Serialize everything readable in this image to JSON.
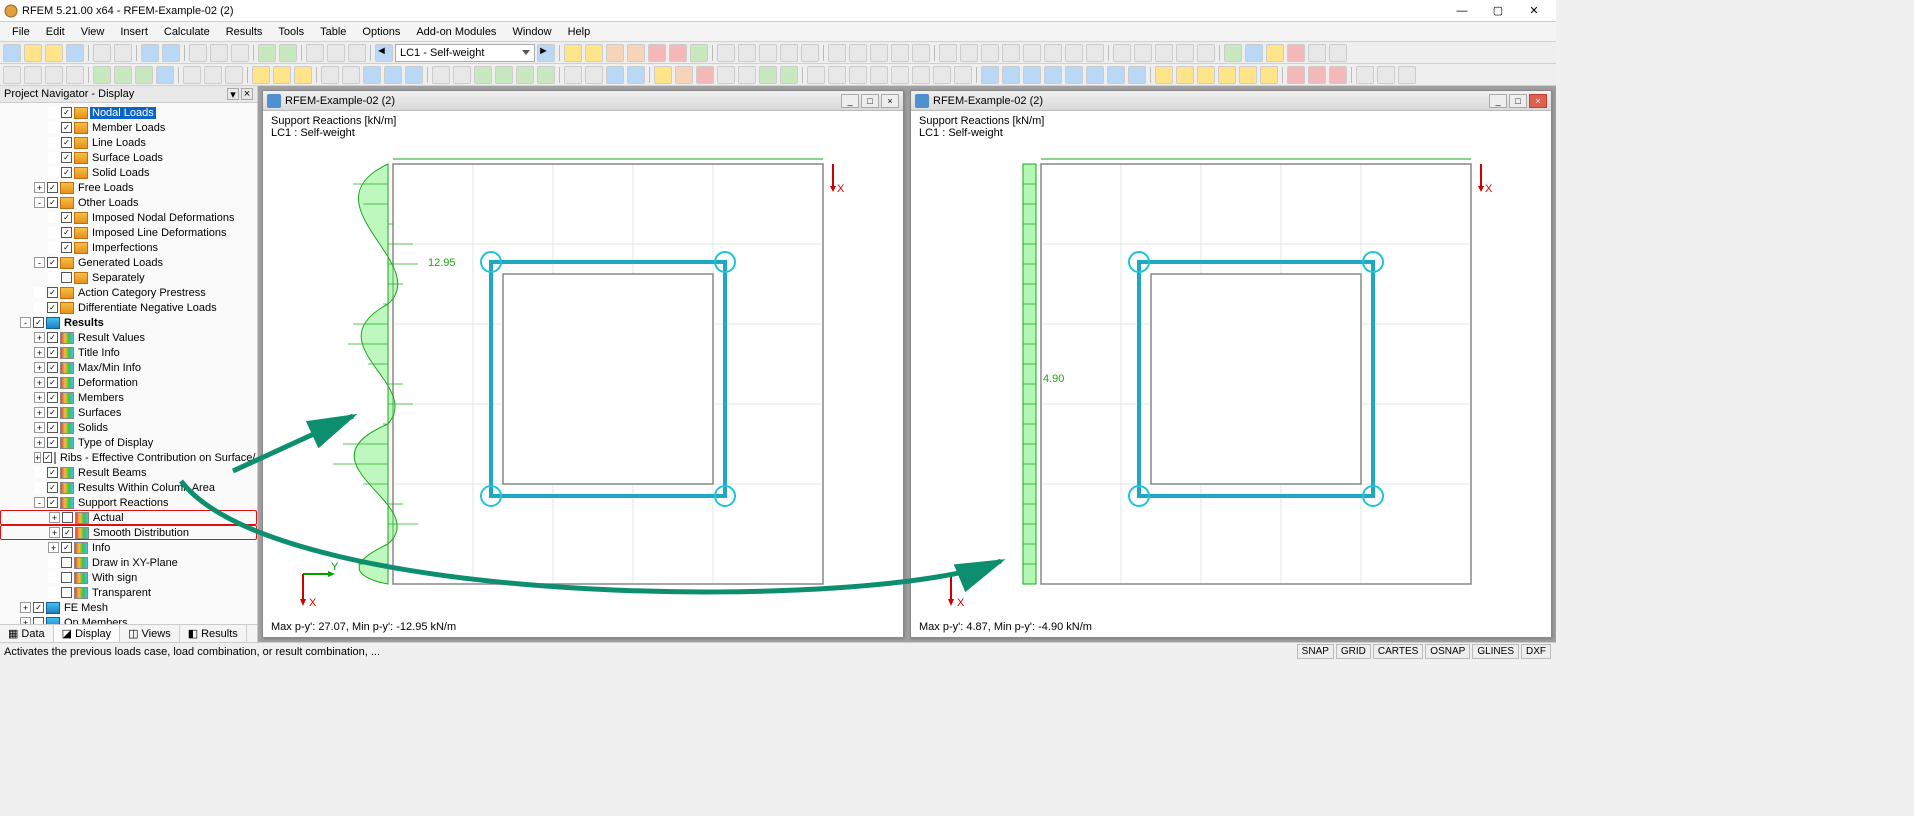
{
  "window": {
    "title": "RFEM 5.21.00 x64 - RFEM-Example-02 (2)"
  },
  "menu": {
    "items": [
      "File",
      "Edit",
      "View",
      "Insert",
      "Calculate",
      "Results",
      "Tools",
      "Table",
      "Options",
      "Add-on Modules",
      "Window",
      "Help"
    ]
  },
  "loadcase_combo": "LC1 - Self-weight",
  "navigator": {
    "title": "Project Navigator - Display",
    "tree": [
      {
        "indent": 3,
        "exp": "",
        "chk": true,
        "icon": "load",
        "label": "Nodal Loads",
        "selected": true
      },
      {
        "indent": 3,
        "exp": "",
        "chk": true,
        "icon": "load",
        "label": "Member Loads"
      },
      {
        "indent": 3,
        "exp": "",
        "chk": true,
        "icon": "load",
        "label": "Line Loads"
      },
      {
        "indent": 3,
        "exp": "",
        "chk": true,
        "icon": "load",
        "label": "Surface Loads"
      },
      {
        "indent": 3,
        "exp": "",
        "chk": true,
        "icon": "load",
        "label": "Solid Loads"
      },
      {
        "indent": 2,
        "exp": "+",
        "chk": true,
        "icon": "load",
        "label": "Free Loads"
      },
      {
        "indent": 2,
        "exp": "-",
        "chk": true,
        "icon": "load",
        "label": "Other Loads"
      },
      {
        "indent": 3,
        "exp": "",
        "chk": true,
        "icon": "load",
        "label": "Imposed Nodal Deformations"
      },
      {
        "indent": 3,
        "exp": "",
        "chk": true,
        "icon": "load",
        "label": "Imposed Line Deformations"
      },
      {
        "indent": 3,
        "exp": "",
        "chk": true,
        "icon": "load",
        "label": "Imperfections"
      },
      {
        "indent": 2,
        "exp": "-",
        "chk": true,
        "icon": "load",
        "label": "Generated Loads"
      },
      {
        "indent": 3,
        "exp": "",
        "chk": false,
        "icon": "load",
        "label": "Separately"
      },
      {
        "indent": 2,
        "exp": "",
        "chk": true,
        "icon": "load",
        "label": "Action Category Prestress"
      },
      {
        "indent": 2,
        "exp": "",
        "chk": true,
        "icon": "load",
        "label": "Differentiate Negative Loads"
      },
      {
        "indent": 1,
        "exp": "-",
        "chk": true,
        "icon": "res",
        "label": "Results",
        "bold": true
      },
      {
        "indent": 2,
        "exp": "+",
        "chk": true,
        "icon": "grad",
        "label": "Result Values"
      },
      {
        "indent": 2,
        "exp": "+",
        "chk": true,
        "icon": "grad",
        "label": "Title Info"
      },
      {
        "indent": 2,
        "exp": "+",
        "chk": true,
        "icon": "grad",
        "label": "Max/Min Info"
      },
      {
        "indent": 2,
        "exp": "+",
        "chk": true,
        "icon": "grad",
        "label": "Deformation"
      },
      {
        "indent": 2,
        "exp": "+",
        "chk": true,
        "icon": "grad",
        "label": "Members"
      },
      {
        "indent": 2,
        "exp": "+",
        "chk": true,
        "icon": "grad",
        "label": "Surfaces"
      },
      {
        "indent": 2,
        "exp": "+",
        "chk": true,
        "icon": "grad",
        "label": "Solids"
      },
      {
        "indent": 2,
        "exp": "+",
        "chk": true,
        "icon": "grad",
        "label": "Type of Display"
      },
      {
        "indent": 2,
        "exp": "+",
        "chk": true,
        "icon": "grad",
        "label": "Ribs - Effective Contribution on Surface/"
      },
      {
        "indent": 2,
        "exp": "",
        "chk": true,
        "icon": "grad",
        "label": "Result Beams"
      },
      {
        "indent": 2,
        "exp": "",
        "chk": true,
        "icon": "grad",
        "label": "Results Within Column Area"
      },
      {
        "indent": 2,
        "exp": "-",
        "chk": true,
        "icon": "grad",
        "label": "Support Reactions"
      },
      {
        "indent": 3,
        "exp": "+",
        "chk": false,
        "icon": "grad",
        "label": "Actual",
        "hl": true
      },
      {
        "indent": 3,
        "exp": "+",
        "chk": true,
        "icon": "grad",
        "label": "Smooth Distribution",
        "hl": true
      },
      {
        "indent": 3,
        "exp": "+",
        "chk": true,
        "icon": "grad",
        "label": "Info"
      },
      {
        "indent": 3,
        "exp": "",
        "chk": false,
        "icon": "grad",
        "label": "Draw in XY-Plane"
      },
      {
        "indent": 3,
        "exp": "",
        "chk": false,
        "icon": "grad",
        "label": "With sign"
      },
      {
        "indent": 3,
        "exp": "",
        "chk": false,
        "icon": "grad",
        "label": "Transparent"
      },
      {
        "indent": 1,
        "exp": "+",
        "chk": true,
        "icon": "res",
        "label": "FE Mesh"
      },
      {
        "indent": 1,
        "exp": "+",
        "chk": false,
        "icon": "res",
        "label": "On Members"
      }
    ],
    "tabs": [
      {
        "label": "Data",
        "active": false
      },
      {
        "label": "Display",
        "active": true
      },
      {
        "label": "Views",
        "active": false
      },
      {
        "label": "Results",
        "active": false
      }
    ]
  },
  "views": [
    {
      "title": "RFEM-Example-02 (2)",
      "info_line1": "Support Reactions [kN/m]",
      "info_line2": "LC1 : Self-weight",
      "footer": "Max p-y': 27.07, Min p-y': -12.95 kN/m",
      "peak_value": "12.95",
      "distribution": "actual"
    },
    {
      "title": "RFEM-Example-02 (2)",
      "info_line1": "Support Reactions [kN/m]",
      "info_line2": "LC1 : Self-weight",
      "footer": "Max p-y': 4.87, Min p-y': -4.90 kN/m",
      "peak_value": "4.90",
      "distribution": "smooth"
    }
  ],
  "statusbar": {
    "message": "Activates the previous loads case, load combination, or result combination, ...",
    "cells": [
      "SNAP",
      "GRID",
      "CARTES",
      "OSNAP",
      "GLINES",
      "DXF"
    ]
  }
}
